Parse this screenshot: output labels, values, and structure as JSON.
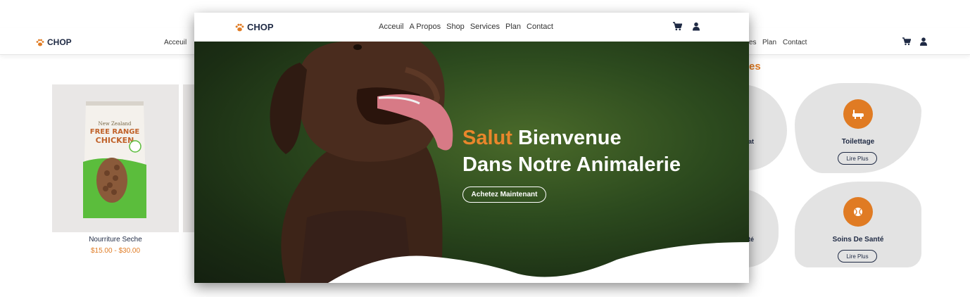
{
  "brand": {
    "name": "CHOP",
    "accent": "#e07b23",
    "dark": "#1f2a44"
  },
  "background_page": {
    "nav": {
      "links_left": [
        "Acceuil"
      ],
      "links_right": [
        "es",
        "Plan",
        "Contact"
      ]
    },
    "section_title_fragment": "es",
    "product": {
      "name": "Nourriture Seche",
      "price": "$15.00 - $30.00"
    },
    "services": [
      {
        "name": "Toilettage",
        "button": "Lire Plus",
        "icon": "bath-icon"
      },
      {
        "name": "Soins De Santé",
        "button": "Lire Plus",
        "icon": "ball-icon"
      }
    ],
    "service_fragments": [
      "at",
      "té"
    ]
  },
  "window": {
    "nav": {
      "links": [
        "Acceuil",
        "A Propos",
        "Shop",
        "Services",
        "Plan",
        "Contact"
      ],
      "icons": [
        "cart-icon",
        "user-icon"
      ]
    },
    "hero": {
      "title_accent": "Salut",
      "title_rest": " Bienvenue",
      "title_line2": "Dans Notre Animalerie",
      "cta": "Achetez Maintenant"
    }
  }
}
